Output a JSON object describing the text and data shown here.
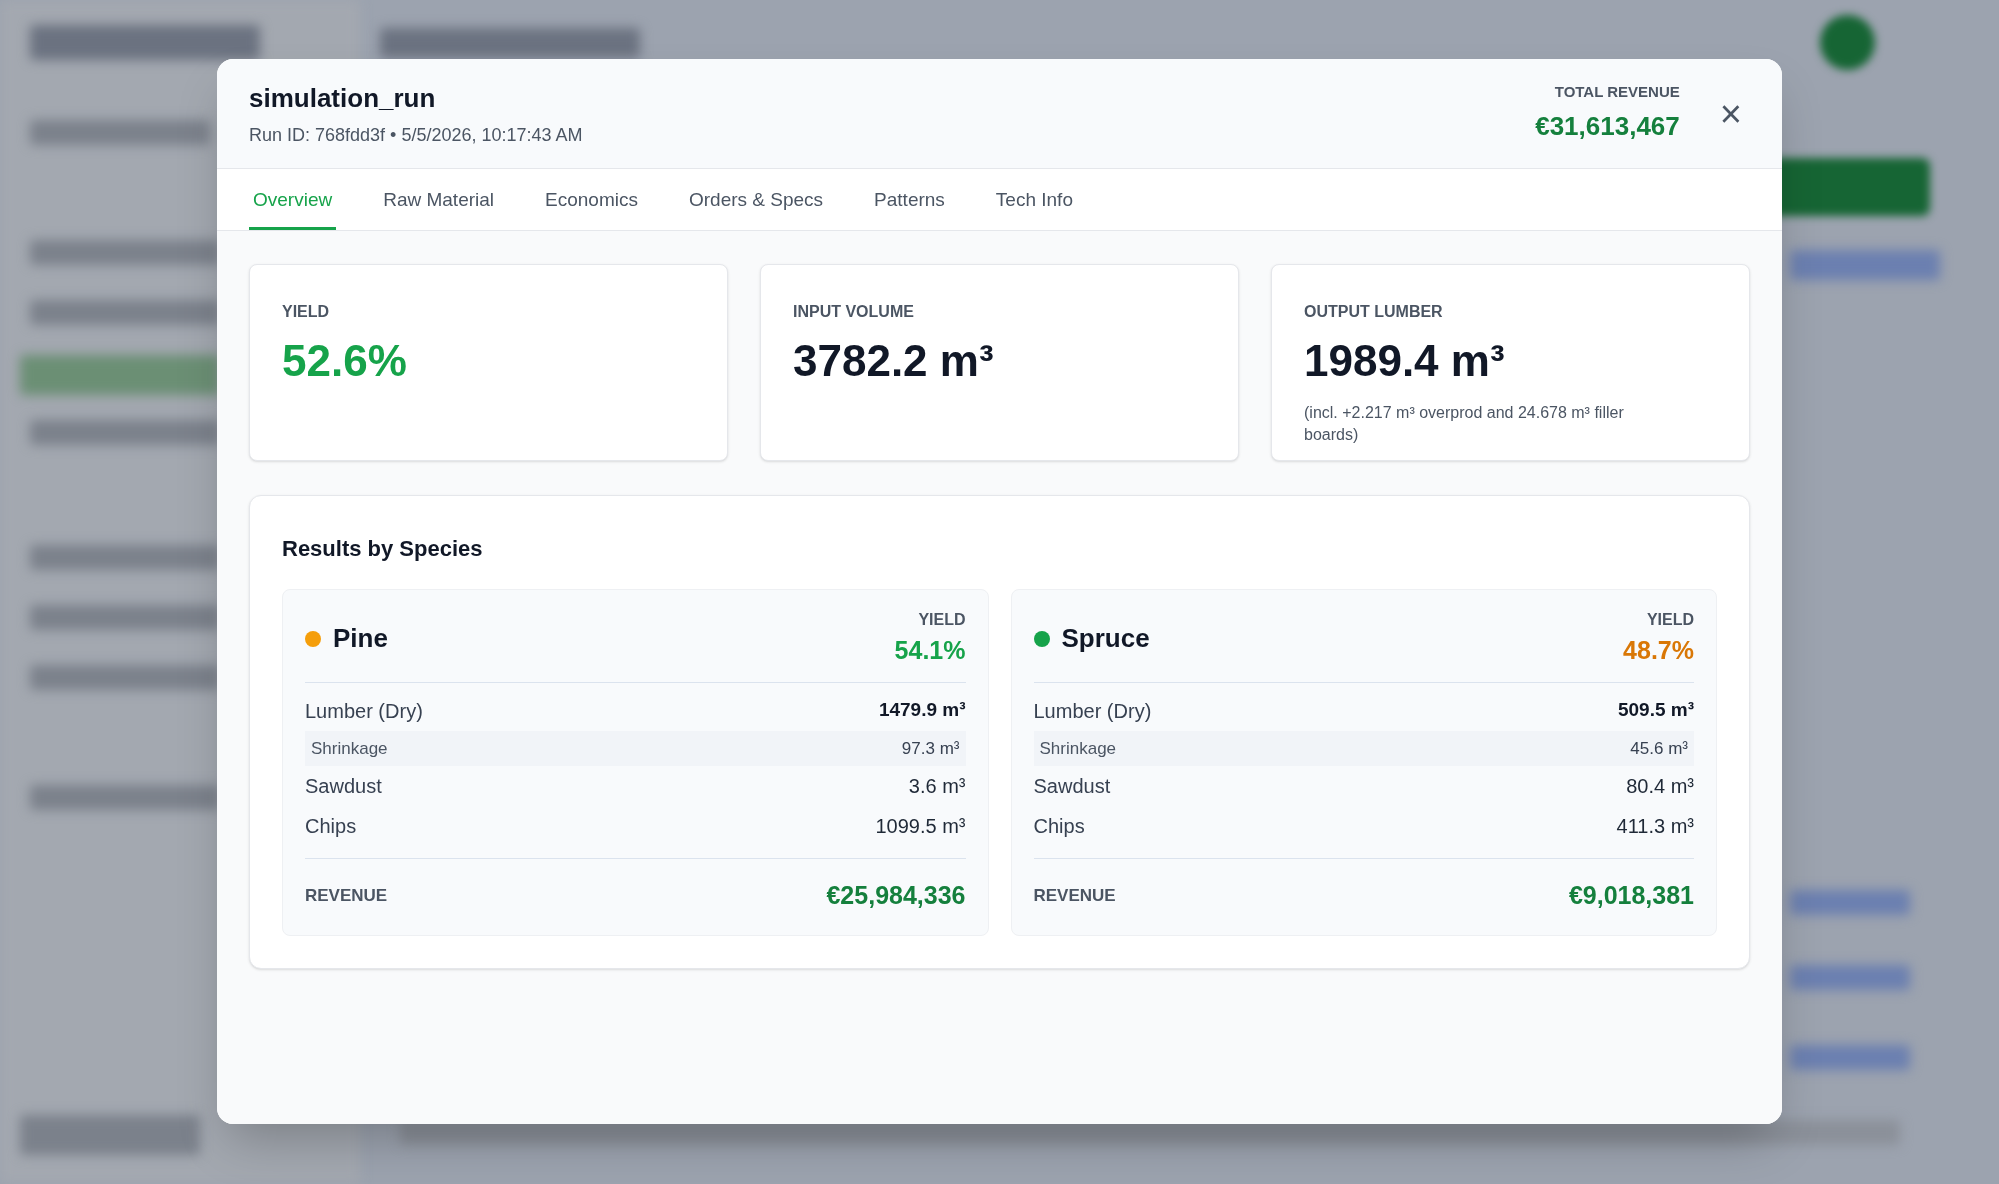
{
  "dialog": {
    "title": "simulation_run",
    "subtitle": "Run ID: 768fdd3f • 5/5/2026, 10:17:43 AM",
    "total_revenue": {
      "label": "TOTAL REVENUE",
      "value": "€31,613,467"
    },
    "close": "×"
  },
  "tabs": [
    {
      "label": "Overview",
      "selected": true
    },
    {
      "label": "Raw Material",
      "selected": false
    },
    {
      "label": "Economics",
      "selected": false
    },
    {
      "label": "Orders & Specs",
      "selected": false
    },
    {
      "label": "Patterns",
      "selected": false
    },
    {
      "label": "Tech Info",
      "selected": false
    }
  ],
  "stats": [
    {
      "label": "YIELD",
      "value": "52.6%",
      "color": "#16a34a"
    },
    {
      "label": "INPUT VOLUME",
      "value": "3782.2 m³",
      "color": "#111827"
    },
    {
      "label": "OUTPUT LUMBER",
      "value": "1989.4 m³",
      "color": "#111827",
      "note": "(incl. +2.217 m³ overprod and 24.678 m³ filler boards)"
    }
  ],
  "species_section": {
    "title": "Results by Species",
    "species": [
      {
        "name": "Pine",
        "color": "#f59e0b",
        "yield": {
          "label": "YIELD",
          "value": "54.1%",
          "color": "#16a34a"
        },
        "rows": [
          {
            "kind": "main",
            "label": "Lumber (Dry)",
            "value": "1479.9 m³"
          },
          {
            "kind": "sub",
            "label": "Shrinkage",
            "value": "97.3 m³"
          },
          {
            "kind": "plain",
            "label": "Sawdust",
            "value": "3.6 m³"
          },
          {
            "kind": "plain",
            "label": "Chips",
            "value": "1099.5 m³"
          }
        ],
        "revenue_label": "REVENUE",
        "revenue": "€25,984,336"
      },
      {
        "name": "Spruce",
        "color": "#16a34a",
        "yield": {
          "label": "YIELD",
          "value": "48.7%",
          "color": "#d97706"
        },
        "rows": [
          {
            "kind": "main",
            "label": "Lumber (Dry)",
            "value": "509.5 m³"
          },
          {
            "kind": "sub",
            "label": "Shrinkage",
            "value": "45.6 m³"
          },
          {
            "kind": "plain",
            "label": "Sawdust",
            "value": "80.4 m³"
          },
          {
            "kind": "plain",
            "label": "Chips",
            "value": "411.3 m³"
          }
        ],
        "revenue_label": "REVENUE",
        "revenue": "€9,018,381"
      }
    ]
  }
}
